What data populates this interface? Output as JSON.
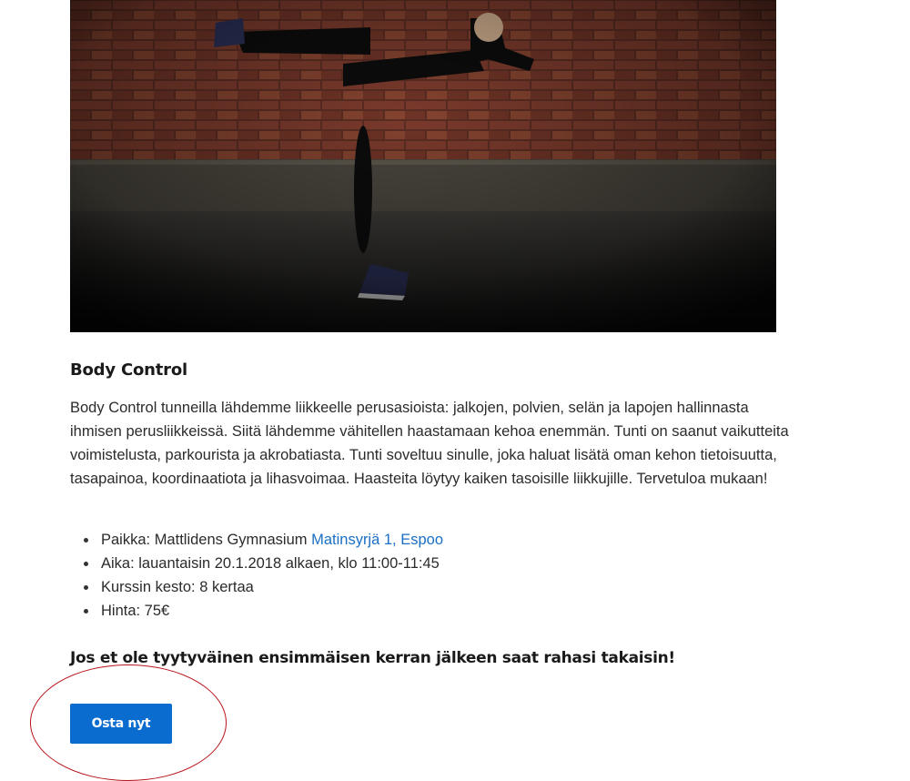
{
  "hero": {
    "image_name": "woman-balancing-exercise-photo"
  },
  "course": {
    "title": "Body Control",
    "description": "Body Control tunneilla lähdemme liikkeelle perusasioista: jalkojen, polvien, selän ja lapojen hallinnasta ihmisen perusliikkeissä. Siitä lähdemme vähitellen haastamaan kehoa enemmän. Tunti on saanut vaikutteita voimistelusta, parkourista ja akrobatiasta. Tunti soveltuu sinulle, joka haluat lisätä oman kehon tietoisuutta, tasapainoa, koordinaatiota ja lihasvoimaa. Haasteita löytyy kaiken tasoisille liikkujille. Tervetuloa mukaan!",
    "details": {
      "place_prefix": "Paikka: Mattlidens Gymnasium ",
      "place_link": "Matinsyrjä 1, Espoo",
      "time": "Aika: lauantaisin 20.1.2018 alkaen, klo 11:00-11:45",
      "duration": "Kurssin kesto: 8 kertaa",
      "price": "Hinta: 75€"
    },
    "guarantee": "Jos et ole tyytyväinen ensimmäisen kerran jälkeen saat rahasi takaisin!",
    "buy_label": "Osta nyt"
  },
  "colors": {
    "link": "#1a6fc4",
    "button": "#0b6ccf",
    "annotation": "#b8151b"
  }
}
